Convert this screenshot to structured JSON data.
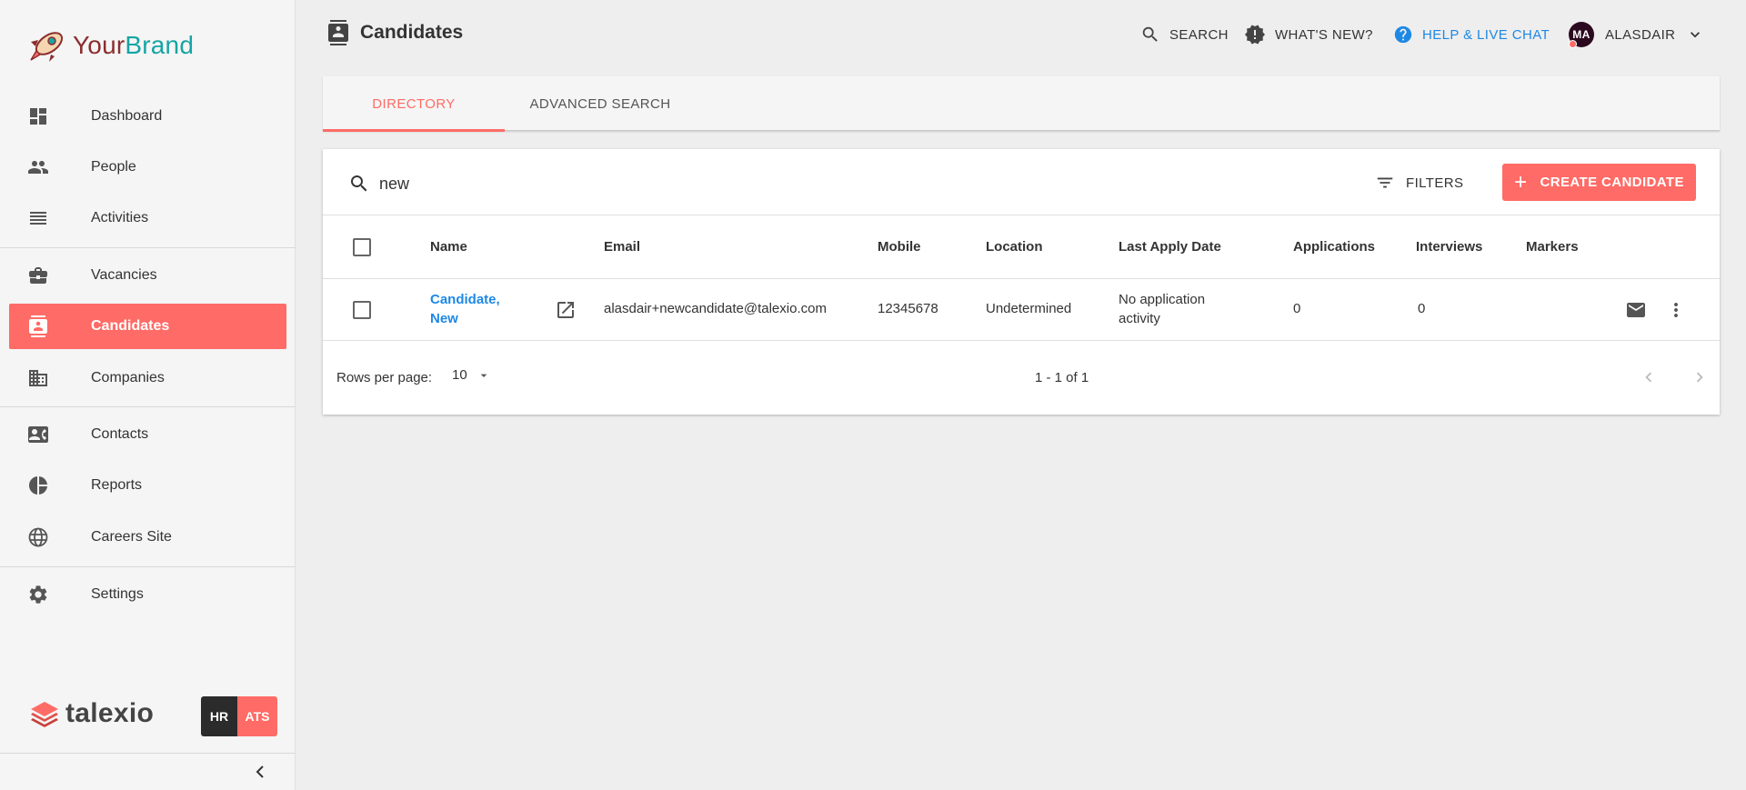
{
  "brand": {
    "part1": "Your",
    "part2": "Brand"
  },
  "sidebar": {
    "items": [
      {
        "label": "Dashboard",
        "icon": "dashboard-icon"
      },
      {
        "label": "People",
        "icon": "people-icon"
      },
      {
        "label": "Activities",
        "icon": "activities-icon"
      },
      {
        "label": "Vacancies",
        "icon": "briefcase-icon"
      },
      {
        "label": "Candidates",
        "icon": "candidate-icon",
        "active": true
      },
      {
        "label": "Companies",
        "icon": "building-icon"
      },
      {
        "label": "Contacts",
        "icon": "contact-card-icon"
      },
      {
        "label": "Reports",
        "icon": "pie-chart-icon"
      },
      {
        "label": "Careers Site",
        "icon": "globe-icon"
      },
      {
        "label": "Settings",
        "icon": "gear-icon"
      }
    ],
    "footer_logo": "talexio",
    "badge_hr": "HR",
    "badge_ats": "ATS"
  },
  "header": {
    "title": "Candidates",
    "search": "SEARCH",
    "whats_new": "WHAT'S NEW?",
    "help": "HELP & LIVE CHAT",
    "avatar_initials": "MA",
    "user_name": "ALASDAIR"
  },
  "tabs": [
    {
      "label": "DIRECTORY",
      "active": true
    },
    {
      "label": "ADVANCED SEARCH",
      "active": false
    }
  ],
  "toolbar": {
    "search_value": "new",
    "filters": "FILTERS",
    "create": "CREATE CANDIDATE"
  },
  "table": {
    "columns": [
      "Name",
      "Email",
      "Mobile",
      "Location",
      "Last Apply Date",
      "Applications",
      "Interviews",
      "Markers"
    ],
    "rows": [
      {
        "name_line1": "Candidate,",
        "name_line2": "New",
        "email": "alasdair+newcandidate@talexio.com",
        "mobile": "12345678",
        "location": "Undetermined",
        "last_apply_line1": "No application",
        "last_apply_line2": "activity",
        "applications": "0",
        "interviews": "0",
        "markers": ""
      }
    ]
  },
  "pagination": {
    "rows_per_page_label": "Rows per page:",
    "rows_per_page": "10",
    "range": "1 - 1 of 1"
  },
  "colors": {
    "accent": "#ff6b66",
    "link": "#1e88e5",
    "brand_dark": "#8b2e2e",
    "brand_teal": "#17a4a4"
  }
}
